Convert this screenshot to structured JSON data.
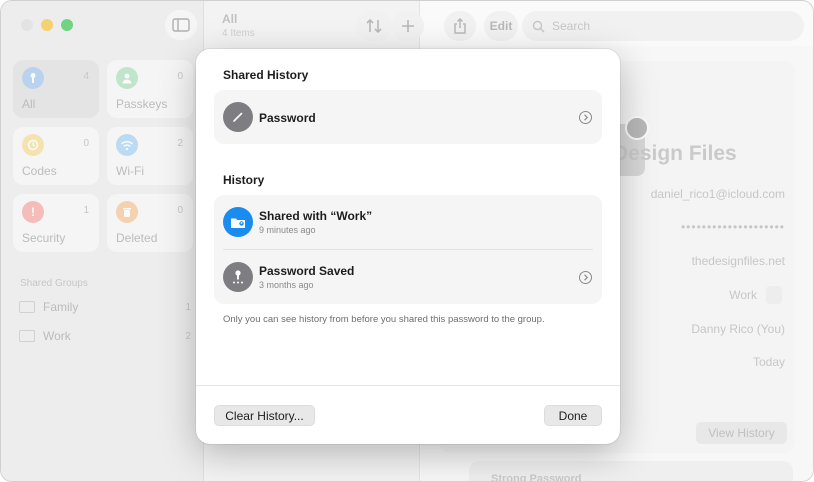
{
  "sidebar": {
    "tiles": [
      {
        "label": "All",
        "count": "4",
        "icon": "key-icon",
        "color": "#2f8bf0"
      },
      {
        "label": "Passkeys",
        "count": "0",
        "icon": "person-icon",
        "color": "#34c759"
      },
      {
        "label": "Codes",
        "count": "0",
        "icon": "clock-icon",
        "color": "#f5b400"
      },
      {
        "label": "Wi-Fi",
        "count": "2",
        "icon": "wifi-icon",
        "color": "#1f95f2"
      },
      {
        "label": "Security",
        "count": "1",
        "icon": "exclamation-icon",
        "color": "#f43a2e"
      },
      {
        "label": "Deleted",
        "count": "0",
        "icon": "trash-icon",
        "color": "#f57a12"
      }
    ],
    "shared_groups_heading": "Shared Groups",
    "groups": [
      {
        "name": "Family",
        "count": "1"
      },
      {
        "name": "Work",
        "count": "2"
      }
    ]
  },
  "list": {
    "title": "All",
    "subtitle": "4 Items"
  },
  "toolbar": {
    "sort_icon": "sort-arrows-icon",
    "add_icon": "plus-icon",
    "share_icon": "share-icon",
    "edit_label": "Edit",
    "search_placeholder": "Search"
  },
  "detail": {
    "title": "Design Files",
    "username": "daniel_rico1@icloud.com",
    "password_mask": "••••••••••••••••••••",
    "website": "thedesignfiles.net",
    "group": "Work",
    "shared_by": "Danny Rico (You)",
    "modified": "Today",
    "view_history_label": "View History",
    "strength_label": "Strong Password"
  },
  "sheet": {
    "shared_history_heading": "Shared History",
    "shared_rows": [
      {
        "title": "Password",
        "icon": "pencil-icon",
        "icon_color": "#7e7e82"
      }
    ],
    "history_heading": "History",
    "history_rows": [
      {
        "title": "Shared with “Work”",
        "subtitle": "9 minutes ago",
        "icon": "shared-folder-icon",
        "icon_color": "#1a8cf0"
      },
      {
        "title": "Password Saved",
        "subtitle": "3 months ago",
        "icon": "key-dots-icon",
        "icon_color": "#7e7e82"
      }
    ],
    "note": "Only you can see history from before you shared this password to the group.",
    "clear_history_label": "Clear History...",
    "done_label": "Done"
  }
}
